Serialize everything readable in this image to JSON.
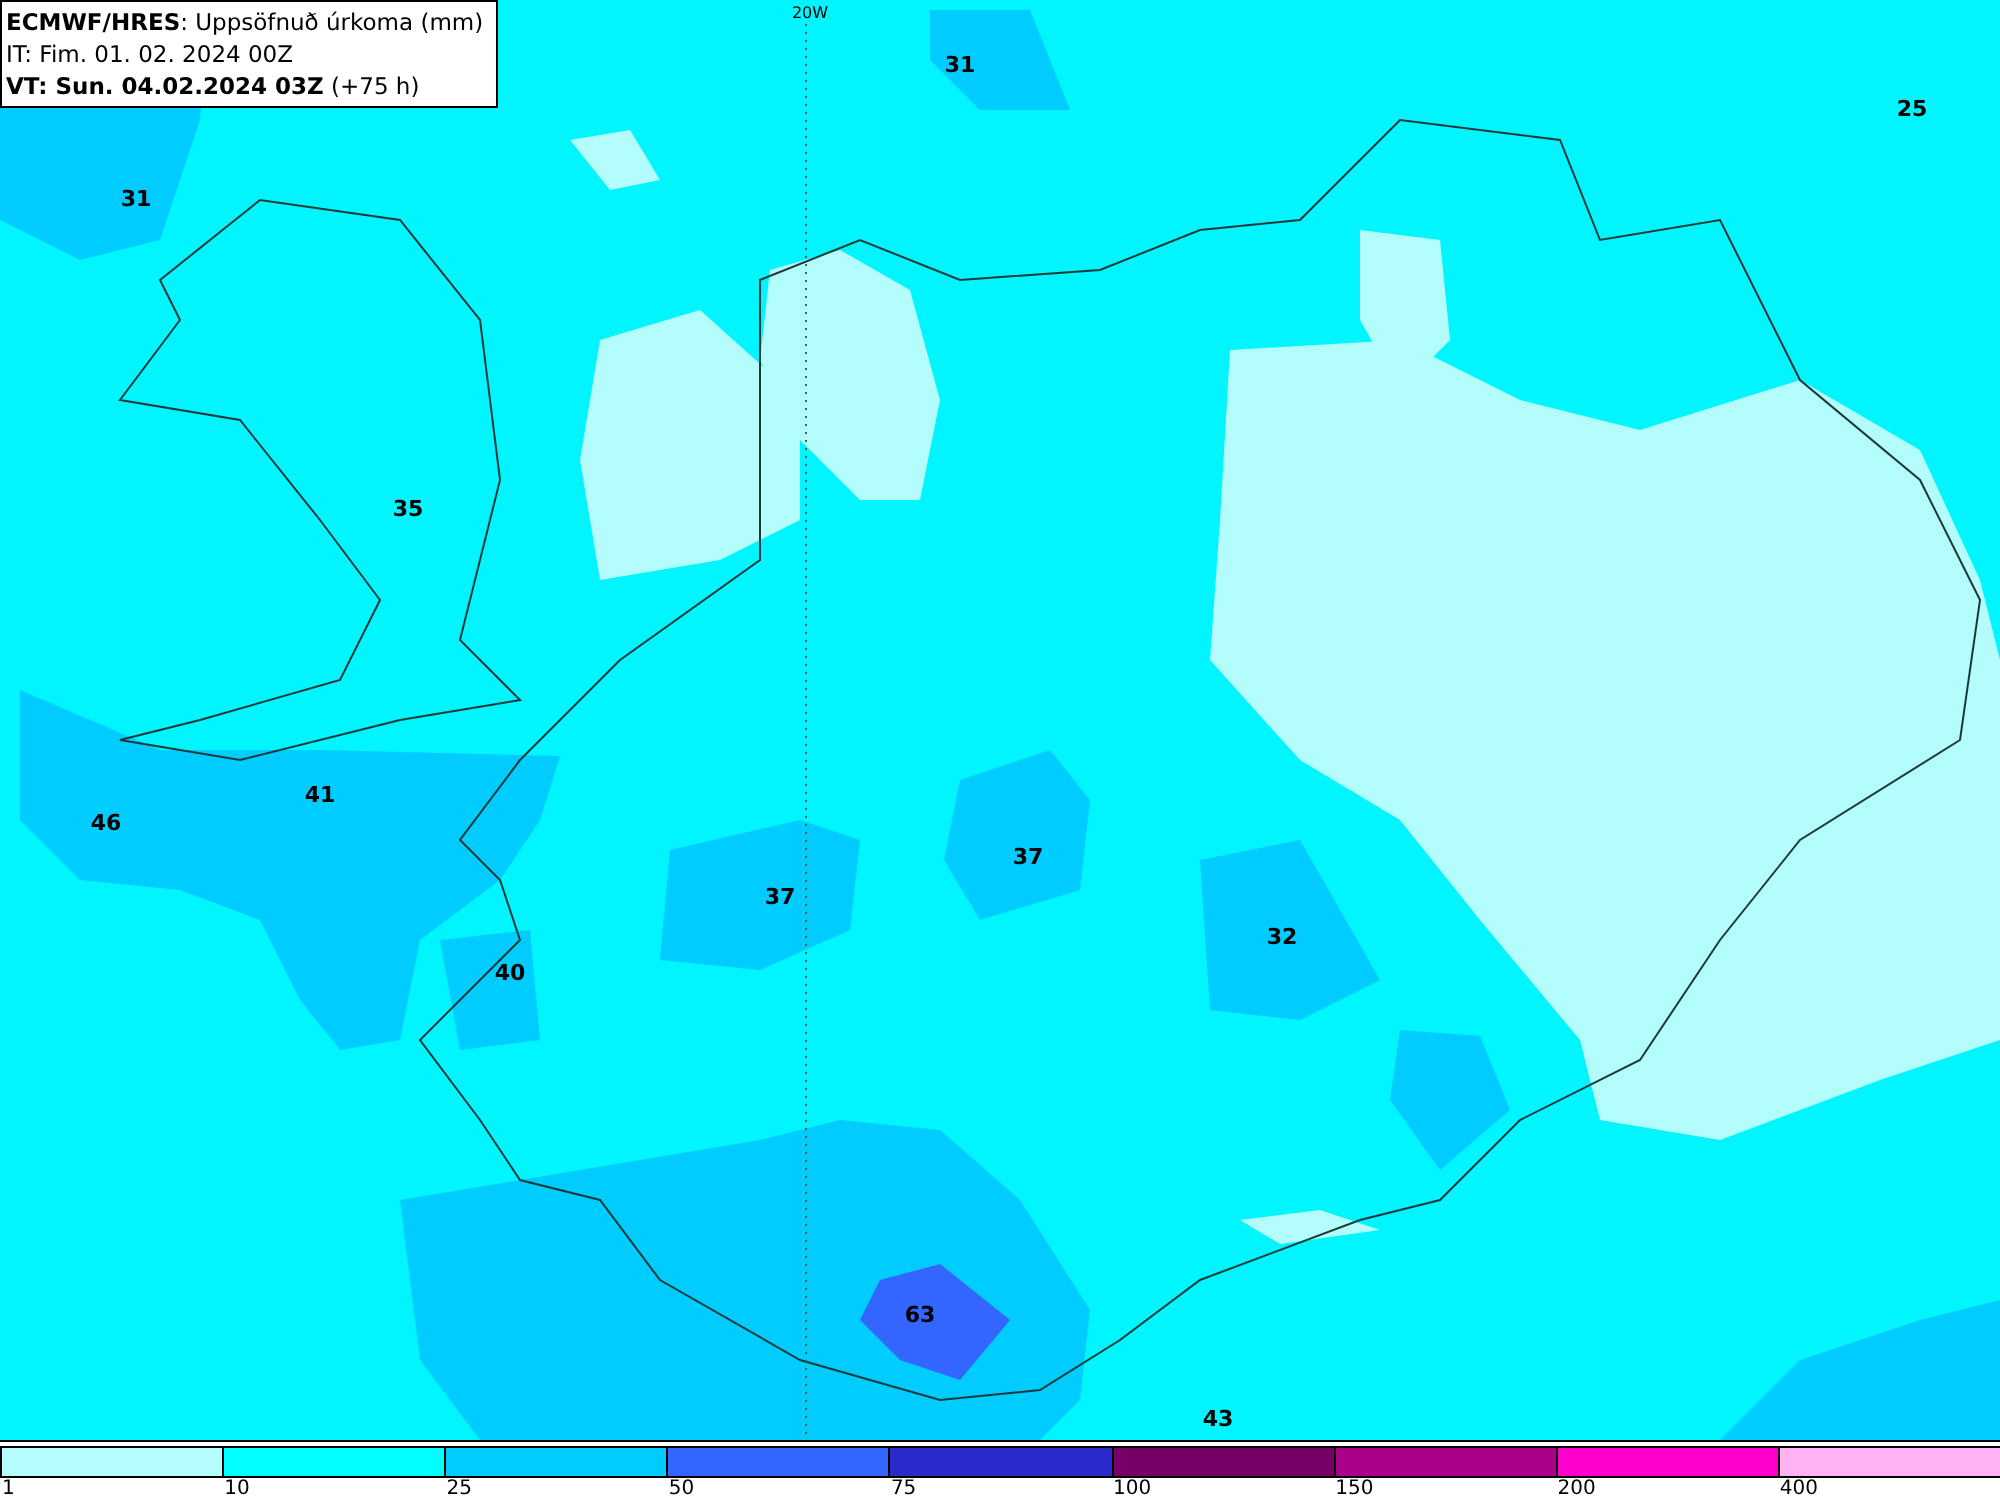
{
  "header": {
    "title": "**ECMWF/HRES**: Uppsöfnuð úrkoma (mm)",
    "init_time": "IT: Fim. 01. 02. 2024 00Z",
    "valid_time": "**VT: Sun. 04.02.2024 03Z** (+75 h)"
  },
  "map": {
    "meridian_label": "20W",
    "values": [
      "31",
      "25",
      "31",
      "35",
      "41",
      "46",
      "37",
      "37",
      "32",
      "40",
      "63",
      "43"
    ]
  },
  "legend": {
    "bins": [
      {
        "color": "#b3fdfd"
      },
      {
        "color": "#00ffff"
      },
      {
        "color": "#00ccff"
      },
      {
        "color": "#3366ff"
      },
      {
        "color": "#2b2bcc"
      },
      {
        "color": "#770066"
      },
      {
        "color": "#aa008a"
      },
      {
        "color": "#ff00cc"
      },
      {
        "color": "#ffb3f5"
      }
    ],
    "ticks": [
      "1",
      "10",
      "25",
      "50",
      "75",
      "100",
      "150",
      "200",
      "400"
    ]
  }
}
